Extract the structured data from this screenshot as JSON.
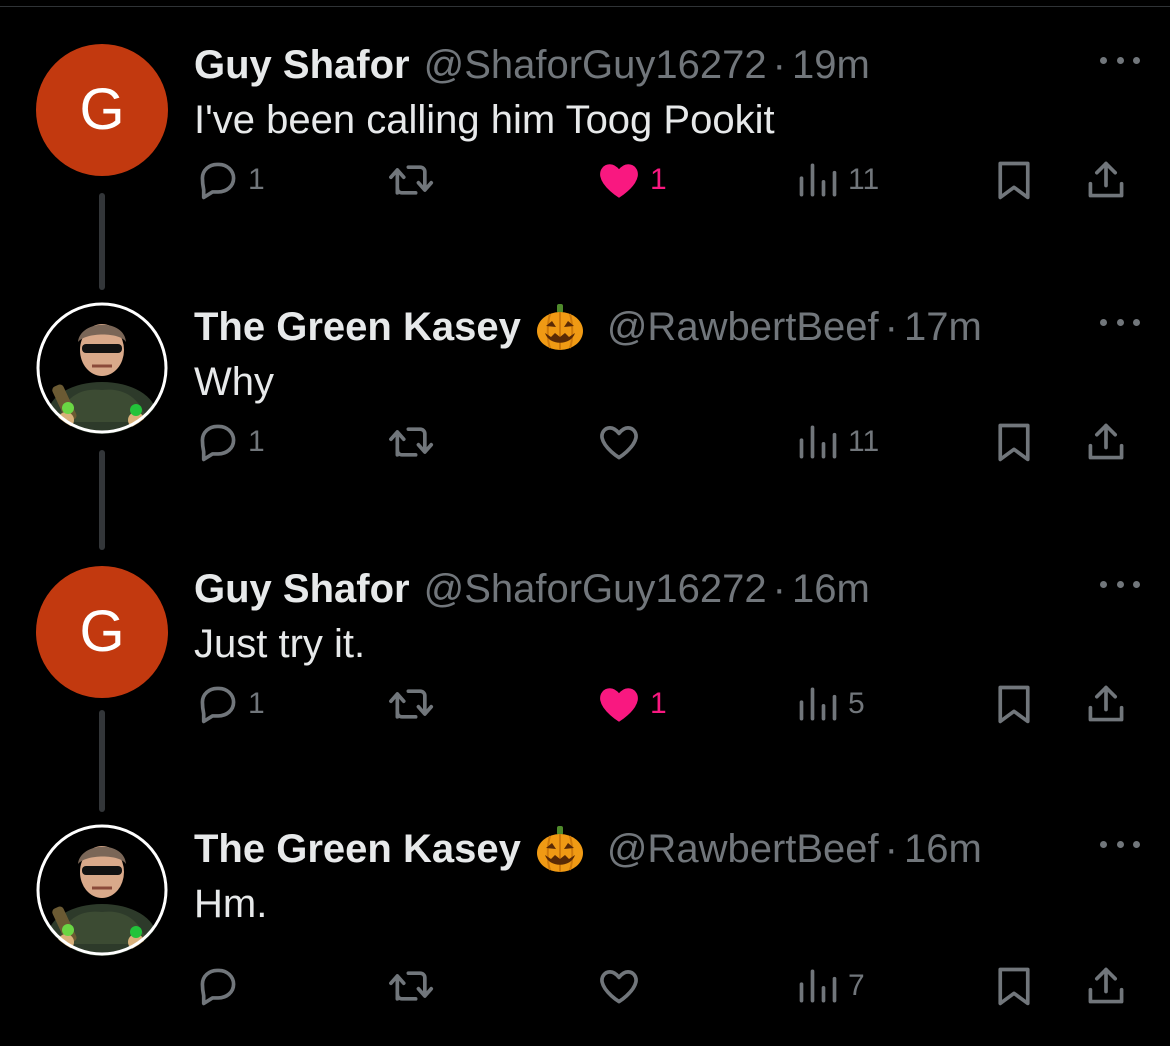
{
  "tweets": [
    {
      "name": "Guy Shafor",
      "handle": "@ShaforGuy16272",
      "dot": "·",
      "time": "19m",
      "text": "I've been calling him Toog Pookit",
      "avatar_type": "letter",
      "avatar_letter": "G",
      "has_emoji": false,
      "reply_count": "1",
      "like_count": "1",
      "liked": true,
      "view_count": "11"
    },
    {
      "name": "The Green Kasey",
      "handle": "@RawbertBeef",
      "dot": "·",
      "time": "17m",
      "text": "Why",
      "avatar_type": "photo",
      "has_emoji": true,
      "reply_count": "1",
      "like_count": "",
      "liked": false,
      "view_count": "11"
    },
    {
      "name": "Guy Shafor",
      "handle": "@ShaforGuy16272",
      "dot": "·",
      "time": "16m",
      "text": "Just try it.",
      "avatar_type": "letter",
      "avatar_letter": "G",
      "has_emoji": false,
      "reply_count": "1",
      "like_count": "1",
      "liked": true,
      "view_count": "5"
    },
    {
      "name": "The Green Kasey",
      "handle": "@RawbertBeef",
      "dot": "·",
      "time": "16m",
      "text": "Hm.",
      "avatar_type": "photo",
      "has_emoji": true,
      "reply_count": "",
      "like_count": "",
      "liked": false,
      "view_count": "7"
    }
  ],
  "icons": {
    "reply": "reply-icon",
    "retweet": "retweet-icon",
    "like": "heart-icon",
    "views": "views-icon",
    "bookmark": "bookmark-icon",
    "share": "share-icon",
    "more": "more-icon",
    "emoji": "jack-o-lantern-icon"
  },
  "colors": {
    "background": "#000000",
    "text": "#e7e9ea",
    "secondary": "#71767b",
    "like": "#f91880",
    "avatar_g": "#c2390f",
    "thread_line": "#333639"
  }
}
